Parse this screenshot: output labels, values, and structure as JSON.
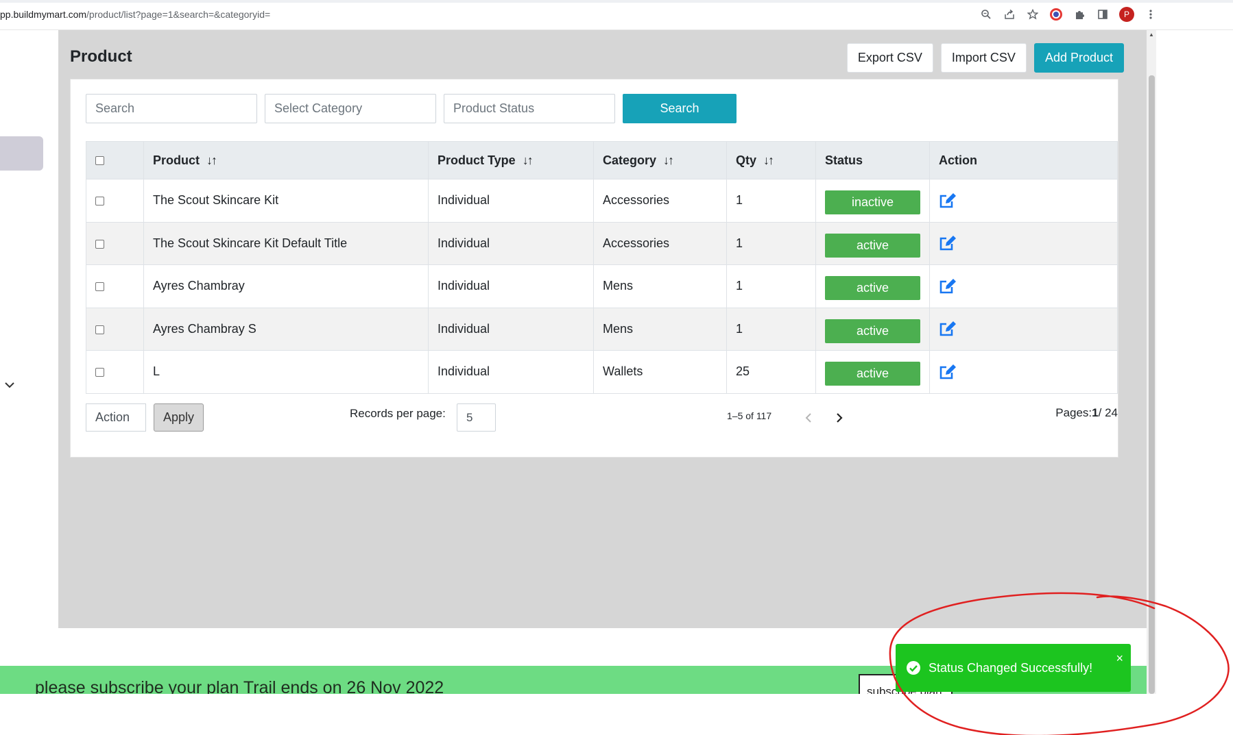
{
  "browser": {
    "url_host": "pp.buildmymart.com",
    "url_path": "/product/list?page=1&search=&categoryid=",
    "profile_initial": "P"
  },
  "page": {
    "title": "Product",
    "export_label": "Export CSV",
    "import_label": "Import CSV",
    "add_label": "Add Product"
  },
  "filters": {
    "search_placeholder": "Search",
    "category_placeholder": "Select Category",
    "status_placeholder": "Product Status",
    "search_button": "Search"
  },
  "table": {
    "columns": [
      "Product",
      "Product Type",
      "Category",
      "Qty",
      "Status",
      "Action"
    ],
    "sort_icon": "↓↑",
    "rows": [
      {
        "product": "The Scout Skincare Kit",
        "type": "Individual",
        "category": "Accessories",
        "qty": "1",
        "status": "inactive"
      },
      {
        "product": "The Scout Skincare Kit Default Title",
        "type": "Individual",
        "category": "Accessories",
        "qty": "1",
        "status": "active"
      },
      {
        "product": "Ayres Chambray",
        "type": "Individual",
        "category": "Mens",
        "qty": "1",
        "status": "active"
      },
      {
        "product": "Ayres Chambray S",
        "type": "Individual",
        "category": "Mens",
        "qty": "1",
        "status": "active"
      },
      {
        "product": "L",
        "type": "Individual",
        "category": "Wallets",
        "qty": "25",
        "status": "active"
      }
    ]
  },
  "footer": {
    "action_label": "Action",
    "apply_label": "Apply",
    "records_label": "Records per page:",
    "records_value": "5",
    "range_text": "1–5 of 117",
    "pages_prefix": "Pages:",
    "pages_current": "1",
    "pages_total": "/ 24"
  },
  "banner": {
    "text": "please subscribe your plan Trail ends on 26 Nov 2022",
    "button": "subscribe plan"
  },
  "toast": {
    "message": "Status Changed Successfully!",
    "close": "×"
  },
  "colors": {
    "primary": "#17a2b8",
    "status_green": "#4caf50",
    "toast_green": "#1cc51f",
    "banner_green": "#6ddc83",
    "annotation_red": "#e02020"
  }
}
